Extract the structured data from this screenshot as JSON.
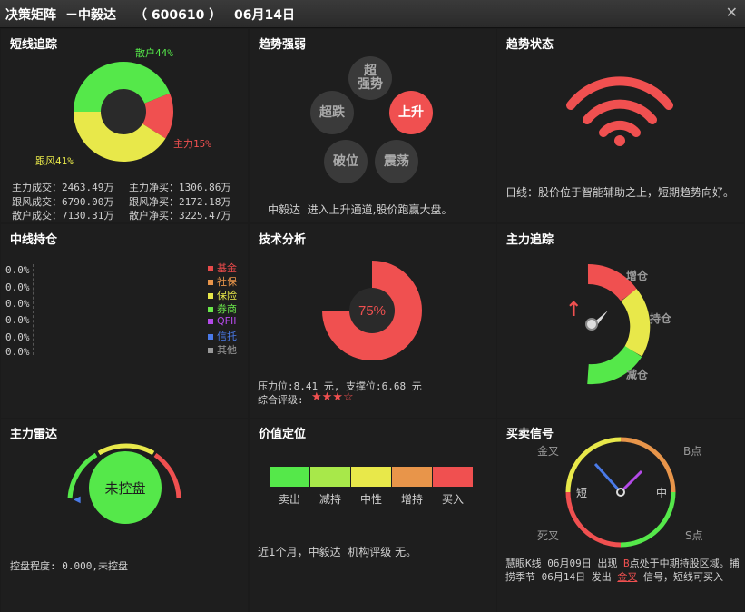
{
  "title": {
    "app": "决策矩阵",
    "stock_name": "－中毅达",
    "code": "（ 600610 ）",
    "date": "06月14日"
  },
  "panels": {
    "short_track": {
      "title": "短线追踪",
      "pie": {
        "retail_label": "散户44%",
        "retail_pct": 44,
        "follow_label": "跟风41%",
        "follow_pct": 41,
        "main_label": "主力15%",
        "main_pct": 15
      },
      "rows": [
        [
          "主力成交：2463.49万",
          "主力净买：1306.86万"
        ],
        [
          "跟风成交：6790.00万",
          "跟风净买：2172.18万"
        ],
        [
          "散户成交：7130.31万",
          "散户净买：3225.47万"
        ]
      ]
    },
    "trend_strength": {
      "title": "趋势强弱",
      "states": {
        "super_strong": "超\n强势",
        "super_fall": "超跌",
        "rise": "上升",
        "break": "破位",
        "shake": "震荡"
      },
      "description": "中毅达  进入上升通道,股价跑赢大盘。"
    },
    "trend_status": {
      "title": "趋势状态",
      "description": "日线：股价位于智能辅助之上，短期趋势向好。"
    },
    "mid_position": {
      "title": "中线持仓",
      "values": [
        "0.0%",
        "0.0%",
        "0.0%",
        "0.0%",
        "0.0%",
        "0.0%"
      ],
      "legend": [
        {
          "label": "基金",
          "color": "#e84a4a"
        },
        {
          "label": "社保",
          "color": "#e8954a"
        },
        {
          "label": "保险",
          "color": "#e8e84a"
        },
        {
          "label": "券商",
          "color": "#6ae84a"
        },
        {
          "label": "QFII",
          "color": "#b44ae8"
        },
        {
          "label": "信托",
          "color": "#4a7ae8"
        },
        {
          "label": "其他",
          "color": "#999999"
        }
      ]
    },
    "tech_analysis": {
      "title": "技术分析",
      "gauge_pct": 75,
      "gauge_label": "75%",
      "pressure": "压力位:8.41 元, 支撑位:6.68 元",
      "rating_label": "综合评级:",
      "rating_stars": "★★★☆",
      "rating_value": 3
    },
    "main_track": {
      "title": "主力追踪",
      "add": "增仓",
      "hold": "持仓",
      "reduce": "减仓",
      "arrow": "↑"
    },
    "main_radar": {
      "title": "主力雷达",
      "center": "未控盘",
      "control": "控盘程度: 0.000,未控盘"
    },
    "value_position": {
      "title": "价值定位",
      "scale": [
        {
          "label": "卖出",
          "color": "#55e84a"
        },
        {
          "label": "减持",
          "color": "#a8e84a"
        },
        {
          "label": "中性",
          "color": "#e8e84a"
        },
        {
          "label": "增持",
          "color": "#e8954a"
        },
        {
          "label": "买入",
          "color": "#f05050"
        }
      ],
      "description": "近1个月，中毅达  机构评级 无。"
    },
    "trade_signal": {
      "title": "买卖信号",
      "gold_cross": "金叉",
      "b_point": "B点",
      "dead_cross": "死叉",
      "s_point": "S点",
      "short": "短",
      "mid": "中",
      "desc1": "慧眼K线 06月09日 出现",
      "desc1_b": "B",
      "desc1_rest": "点处于中期持股区域",
      "desc2": "。捕捞季节 06月14日 发出",
      "desc2_gold": "金叉",
      "desc2_rest": "信号，短线可",
      "desc3": "买入"
    }
  }
}
